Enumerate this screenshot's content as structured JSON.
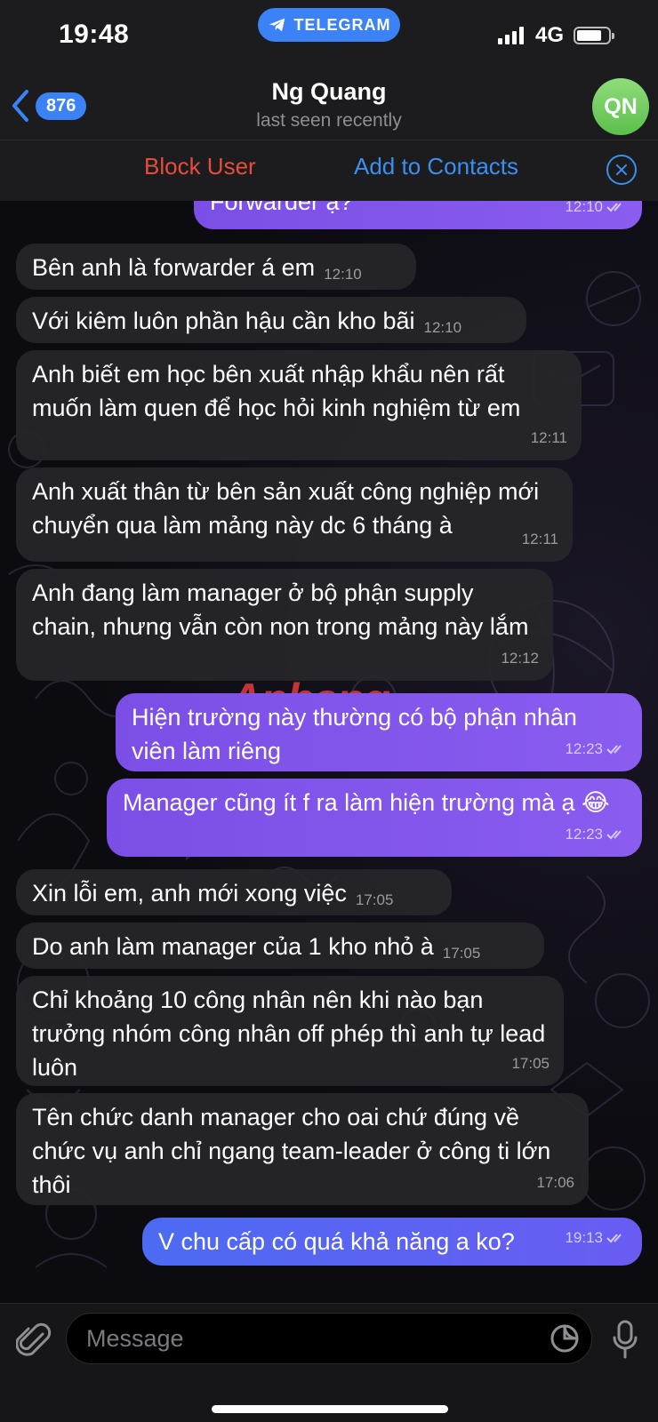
{
  "status": {
    "time": "19:48",
    "app_pill": "TELEGRAM",
    "network": "4G"
  },
  "header": {
    "back_count": "876",
    "name": "Ng Quang",
    "subtitle": "last seen recently",
    "avatar_initials": "QN"
  },
  "actions": {
    "block": "Block User",
    "add": "Add to Contacts"
  },
  "watermark": {
    "main": "Aphang"
  },
  "messages": [
    {
      "dir": "out",
      "text": "Forwarder ạ?",
      "time": "12:10"
    },
    {
      "dir": "in",
      "text": "Bên anh là forwarder á em",
      "time": "12:10"
    },
    {
      "dir": "in",
      "text": "Với kiêm luôn phần hậu cần kho bãi",
      "time": "12:10"
    },
    {
      "dir": "in",
      "text": "Anh biết em học bên xuất nhập khẩu nên rất muốn làm quen để học hỏi kinh nghiệm từ em",
      "time": "12:11"
    },
    {
      "dir": "in",
      "text": "Anh xuất thân từ bên sản xuất công nghiệp mới chuyển qua làm mảng này dc 6 tháng à",
      "time": "12:11"
    },
    {
      "dir": "in",
      "text": "Anh đang làm manager ở bộ phận supply chain, nhưng vẫn còn non trong mảng này lắm",
      "time": "12:12"
    },
    {
      "dir": "out",
      "text": "Hiện trường này thường có bộ phận nhân viên làm riêng",
      "time": "12:23"
    },
    {
      "dir": "out",
      "text": "Manager cũng ít f ra làm hiện trường mà ạ 😂",
      "time": "12:23"
    },
    {
      "dir": "in",
      "text": "Xin lỗi em, anh mới xong việc",
      "time": "17:05"
    },
    {
      "dir": "in",
      "text": "Do anh làm manager của 1 kho nhỏ à",
      "time": "17:05"
    },
    {
      "dir": "in",
      "text": "Chỉ khoảng 10 công nhân nên khi nào bạn trưởng nhóm công nhân off phép thì anh tự lead luôn",
      "time": "17:05"
    },
    {
      "dir": "in",
      "text": "Tên chức danh manager cho oai chứ đúng về chức vụ anh chỉ ngang team-leader ở công ti lớn thôi",
      "time": "17:06"
    },
    {
      "dir": "out",
      "text": "V chu cấp có quá khả năng a ko?",
      "time": "19:13"
    }
  ],
  "input": {
    "placeholder": "Message"
  },
  "colors": {
    "accent": "#3a82f6",
    "danger": "#e74c3c",
    "out_bubble": "#7b4fe6",
    "in_bubble": "#26262a"
  }
}
